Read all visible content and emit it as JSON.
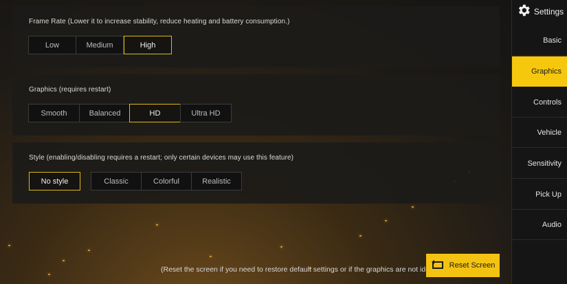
{
  "sidebar": {
    "title": "Settings",
    "items": [
      {
        "label": "Basic"
      },
      {
        "label": "Graphics"
      },
      {
        "label": "Controls"
      },
      {
        "label": "Vehicle"
      },
      {
        "label": "Sensitivity"
      },
      {
        "label": "Pick Up"
      },
      {
        "label": "Audio"
      }
    ]
  },
  "frame_rate": {
    "title": "Frame Rate (Lower it to increase stability, reduce heating and battery consumption.)",
    "options": [
      "Low",
      "Medium",
      "High"
    ],
    "selected": "High"
  },
  "graphics": {
    "title": "Graphics (requires restart)",
    "options": [
      "Smooth",
      "Balanced",
      "HD",
      "Ultra HD"
    ],
    "selected": "HD"
  },
  "style": {
    "title": "Style (enabling/disabling requires a restart; only certain devices may use this feature)",
    "no_style": "No style",
    "options": [
      "Classic",
      "Colorful",
      "Realistic"
    ],
    "selected": "No style"
  },
  "footer": {
    "note": "(Reset the screen if you need to restore default settings or if the graphics are not ideal)",
    "reset_label": "Reset Screen"
  },
  "colors": {
    "accent": "#f6c80d",
    "panel": "#1c1b19",
    "selected_border": "#e2b919"
  }
}
